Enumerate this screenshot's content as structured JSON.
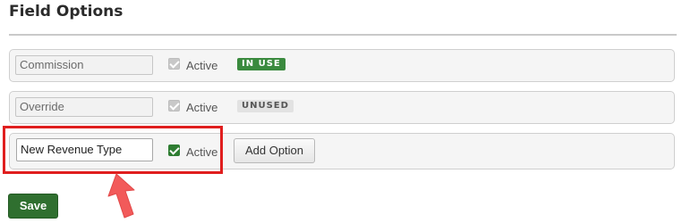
{
  "page": {
    "title": "Field Options"
  },
  "options": [
    {
      "value": "Commission",
      "active_label": "Active",
      "active_checked": true,
      "status": "IN USE"
    },
    {
      "value": "Override",
      "active_label": "Active",
      "active_checked": true,
      "status": "UNUSED"
    }
  ],
  "new_option": {
    "value": "New Revenue Type",
    "active_label": "Active",
    "active_checked": true,
    "add_button_label": "Add Option"
  },
  "footer": {
    "save_label": "Save"
  },
  "colors": {
    "accent_green": "#2e7d32",
    "in_use_badge": "#3a8a3e",
    "highlight_red": "#e01e1e",
    "arrow_red": "#f25a5a"
  },
  "icons": {
    "pointer": "arrow-up-icon"
  }
}
